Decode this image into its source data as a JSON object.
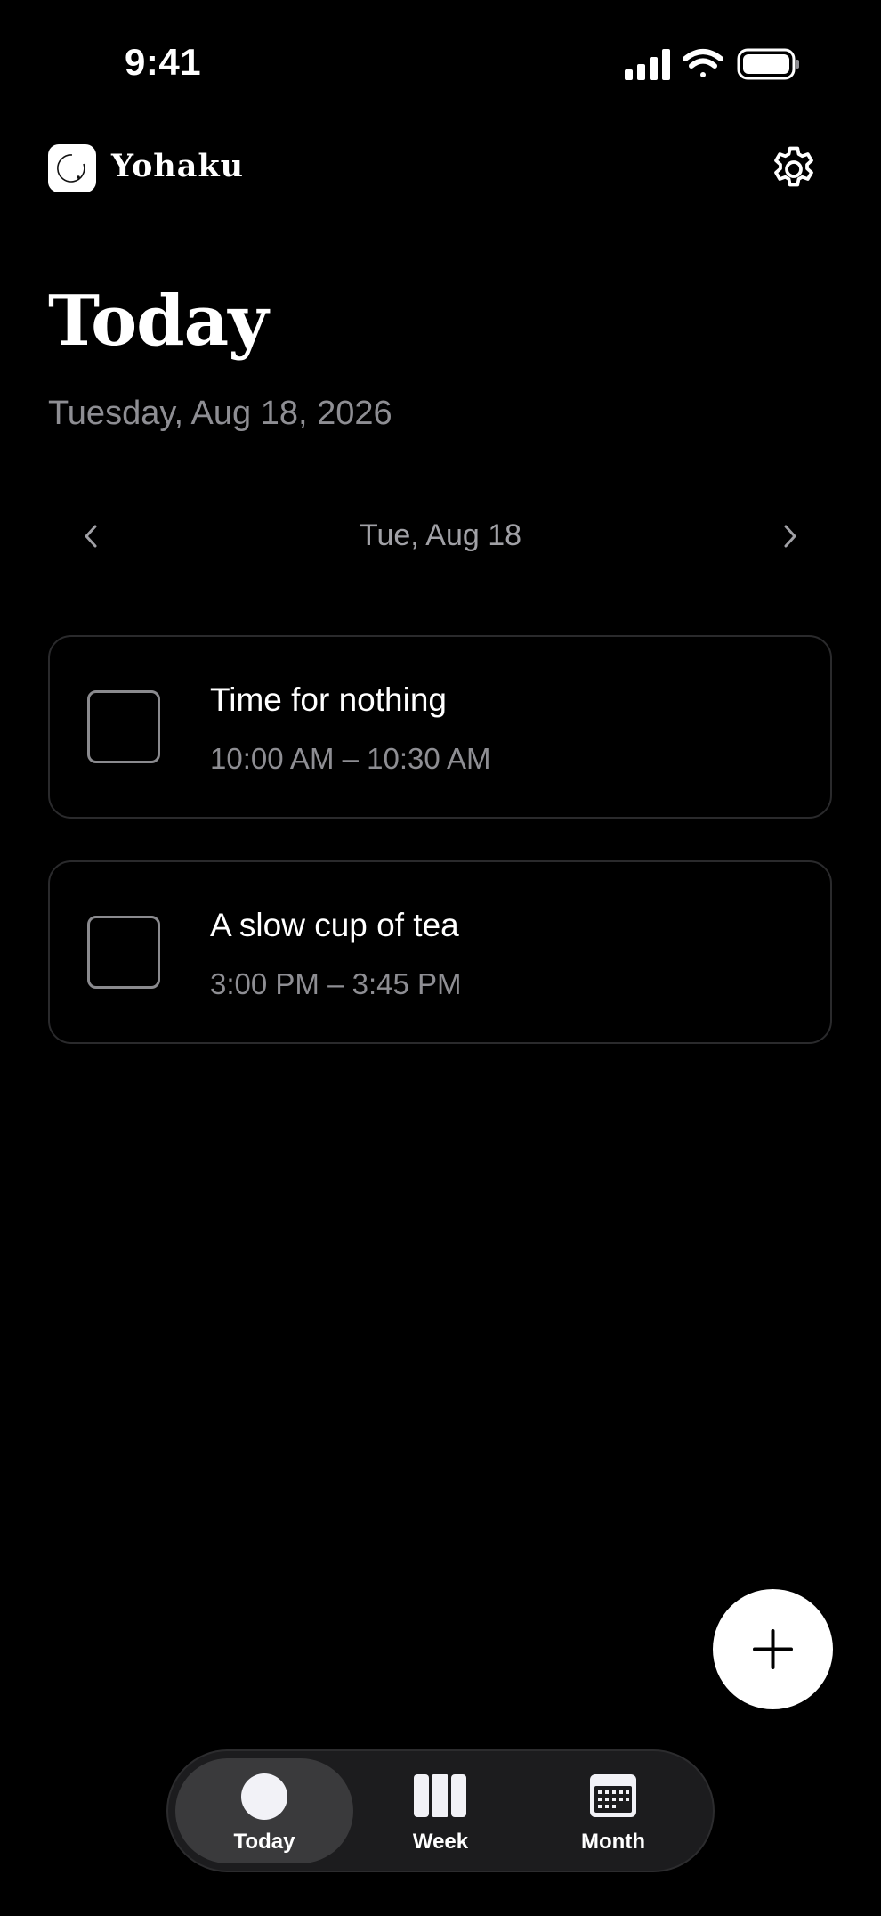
{
  "status_bar": {
    "time": "9:41",
    "icons": [
      "cellular-signal-icon",
      "wifi-icon",
      "battery-icon"
    ]
  },
  "header": {
    "app_name": "Yohaku",
    "app_icon": "yohaku-logo-icon",
    "settings_icon": "gear-icon"
  },
  "page": {
    "title": "Today",
    "date": "Tuesday, Aug 18, 2026"
  },
  "date_nav": {
    "label": "Tue, Aug 18",
    "prev_icon": "chevron-left-icon",
    "next_icon": "chevron-right-icon"
  },
  "tasks": [
    {
      "title": "Time for nothing",
      "time": "10:00 AM – 10:30 AM",
      "completed": false
    },
    {
      "title": "A slow cup of tea",
      "time": "3:00 PM – 3:45 PM",
      "completed": false
    }
  ],
  "fab": {
    "icon": "plus-icon"
  },
  "tabs": [
    {
      "label": "Today",
      "icon": "circle-icon",
      "active": true
    },
    {
      "label": "Week",
      "icon": "week-columns-icon",
      "active": false
    },
    {
      "label": "Month",
      "icon": "calendar-grid-icon",
      "active": false
    }
  ],
  "colors": {
    "background": "#000000",
    "text_primary": "#ffffff",
    "text_secondary": "#8e8e93",
    "card_border": "#2a2a2c",
    "tab_bar": "#1c1c1e",
    "tab_active": "#3a3a3c"
  }
}
